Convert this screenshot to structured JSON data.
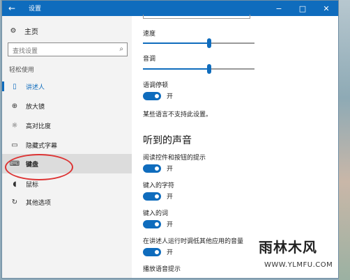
{
  "window": {
    "title": "设置",
    "back_icon": "←",
    "minimize_icon": "−",
    "maximize_icon": "□",
    "close_icon": "✕"
  },
  "sidebar": {
    "home_label": "主页",
    "search_placeholder": "查找设置",
    "section_label": "轻松使用",
    "items": [
      {
        "label": "讲述人",
        "icon": "narrator-icon",
        "glyph": "▯"
      },
      {
        "label": "放大镜",
        "icon": "magnifier-icon",
        "glyph": "⊕"
      },
      {
        "label": "高对比度",
        "icon": "high-contrast-icon",
        "glyph": "☼"
      },
      {
        "label": "隐藏式字幕",
        "icon": "closed-captions-icon",
        "glyph": "▭"
      },
      {
        "label": "键盘",
        "icon": "keyboard-icon",
        "glyph": "⌨"
      },
      {
        "label": "鼠标",
        "icon": "mouse-icon",
        "glyph": "◖"
      },
      {
        "label": "其他选项",
        "icon": "other-options-icon",
        "glyph": "↻"
      }
    ]
  },
  "main": {
    "speed_label": "速度",
    "pitch_label": "音调",
    "pause_label": "语调停顿",
    "pause_state": "开",
    "unsupported_note": "某些语言不支持此设置。",
    "section_heading": "听到的声音",
    "toggles": [
      {
        "label": "阅读控件和按钮的提示",
        "state": "开"
      },
      {
        "label": "键入的字符",
        "state": "开"
      },
      {
        "label": "键入的词",
        "state": "开"
      },
      {
        "label": "在讲述人运行时调低其他应用的音量",
        "state": "开"
      },
      {
        "label": "播放语音提示",
        "state": ""
      }
    ]
  },
  "watermark": {
    "title": "雨林木风",
    "url": "WWW.YLMFU.COM"
  },
  "colors": {
    "accent": "#0f6cbd",
    "highlight": "#dd3333"
  }
}
